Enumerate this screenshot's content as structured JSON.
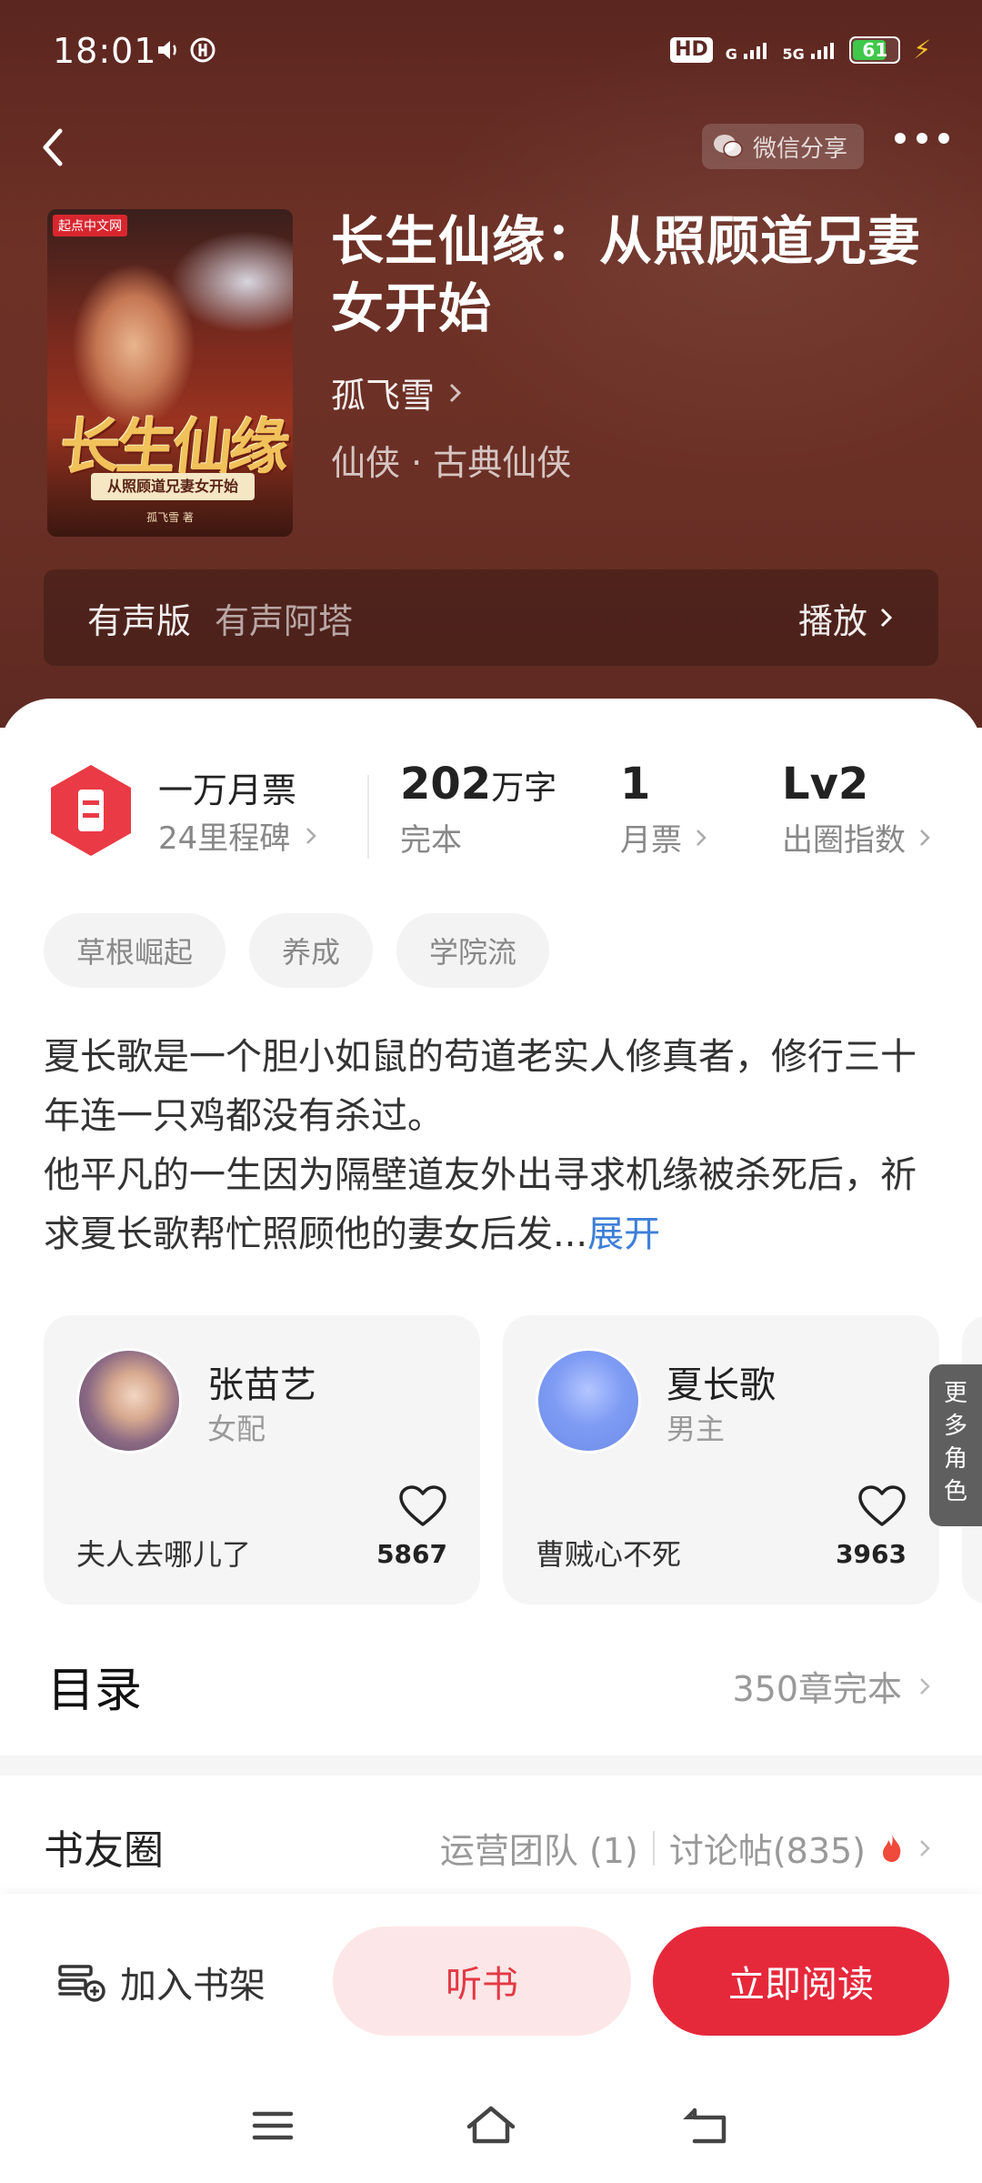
{
  "status_bar": {
    "time": "18:01",
    "hd_label": "HD",
    "network_1": "G",
    "network_2": "5G",
    "battery": "61"
  },
  "header": {
    "share_label": "微信分享"
  },
  "book": {
    "cover_badge": "起点中文网",
    "cover_title": "长生仙缘",
    "cover_subtitle": "从照顾道兄妻女开始",
    "cover_author": "孤飞雪 著",
    "title": "长生仙缘：从照顾道兄妻女开始",
    "author": "孤飞雪",
    "genre": "仙侠 · 古典仙侠"
  },
  "audio": {
    "label": "有声版",
    "source": "有声阿塔",
    "play_label": "播放"
  },
  "stats": {
    "milestone_title": "一万月票",
    "milestone_sub": "24里程碑",
    "words_value": "202",
    "words_unit": "万字",
    "words_status": "完本",
    "monthly_votes_value": "1",
    "monthly_votes_label": "月票",
    "influence_value": "Lv2",
    "influence_label": "出圈指数"
  },
  "tags": [
    "草根崛起",
    "养成",
    "学院流"
  ],
  "synopsis": {
    "text": "夏长歌是一个胆小如鼠的苟道老实人修真者，修行三十年连一只鸡都没有杀过。\n他平凡的一生因为隔壁道友外出寻求机缘被杀死后，祈求夏长歌帮忙照顾他的妻女后发...",
    "expand_label": "展开"
  },
  "characters": [
    {
      "name": "张苗艺",
      "role": "女配",
      "quote": "夫人去哪儿了",
      "likes": "5867"
    },
    {
      "name": "夏长歌",
      "role": "男主",
      "quote": "曹贼心不死",
      "likes": "3963"
    }
  ],
  "more_roles_label": "更多角色",
  "toc": {
    "title": "目录",
    "info": "350章完本"
  },
  "book_circle": {
    "title": "书友圈",
    "ops_team": "运营团队 (1)",
    "discussions": "讨论帖(835)"
  },
  "actions": {
    "add_shelf": "加入书架",
    "listen": "听书",
    "read_now": "立即阅读"
  },
  "colors": {
    "hero_bg": "#6a2f25",
    "accent_red": "#e6283b",
    "link_blue": "#3d7fd8",
    "listen_bg": "#fde6e7"
  }
}
